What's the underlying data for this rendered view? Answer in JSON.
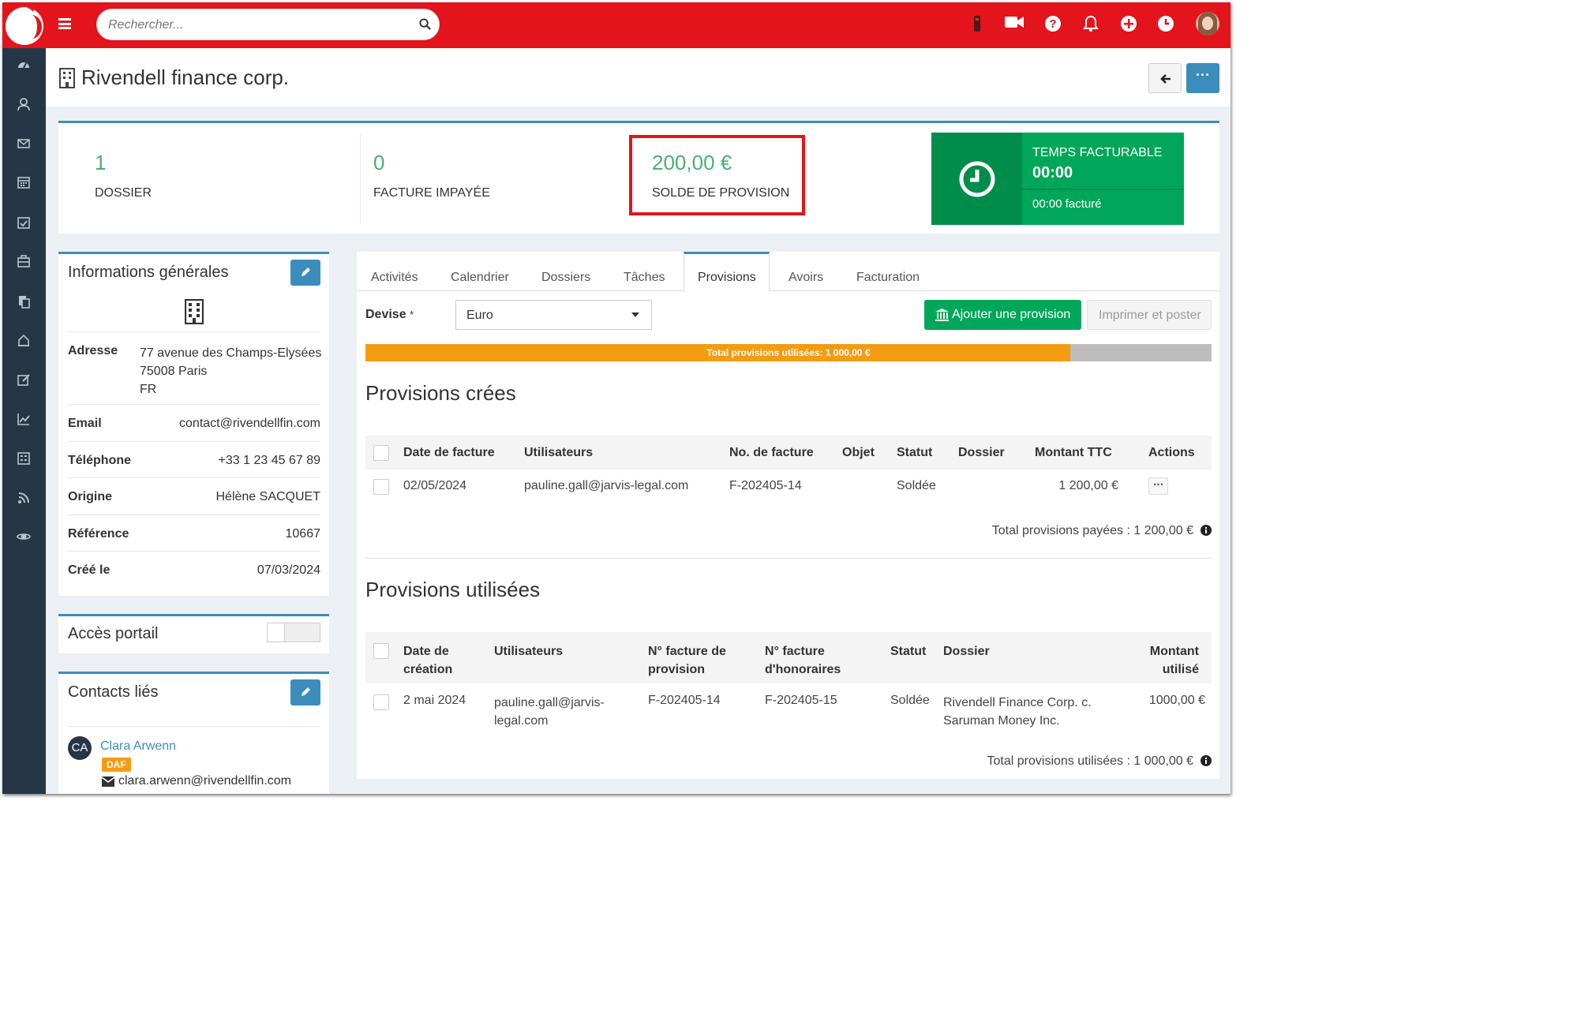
{
  "header": {
    "search_placeholder": "Rechercher..."
  },
  "page": {
    "title": "Rivendell finance corp."
  },
  "stats": {
    "dossier_count": "1",
    "dossier_label": "DOSSIER",
    "facture_count": "0",
    "facture_label": "FACTURE IMPAYÉE",
    "solde_value": "200,00 €",
    "solde_label": "SOLDE DE PROVISION",
    "temps_title": "TEMPS FACTURABLE",
    "temps_value": "00:00",
    "temps_facture": "00:00 facturé"
  },
  "info": {
    "title": "Informations générales",
    "rows": [
      {
        "label": "Adresse",
        "value": [
          "77 avenue des Champs-Elysées",
          "75008 Paris",
          "FR"
        ]
      },
      {
        "label": "Email",
        "value": "contact@rivendellfin.com"
      },
      {
        "label": "Téléphone",
        "value": "+33 1 23 45 67 89"
      },
      {
        "label": "Origine",
        "value": "Hélène SACQUET"
      },
      {
        "label": "Référence",
        "value": "10667"
      },
      {
        "label": "Créé le",
        "value": "07/03/2024"
      }
    ]
  },
  "portail": {
    "title": "Accès portail"
  },
  "contacts": {
    "title": "Contacts liés",
    "items": [
      {
        "initials": "CA",
        "name": "Clara Arwenn",
        "badge": "DAF",
        "email": "clara.arwenn@rivendellfin.com"
      }
    ]
  },
  "tabs": [
    "Activités",
    "Calendrier",
    "Dossiers",
    "Tâches",
    "Provisions",
    "Avoirs",
    "Facturation"
  ],
  "active_tab": "Provisions",
  "provisions": {
    "devise_label": "Devise",
    "devise_required": "*",
    "devise_value": "Euro",
    "add_button": "Ajouter une provision",
    "print_button": "Imprimer et poster",
    "progress_label": "Total provisions utilisées: 1 000,00 €",
    "progress_fraction": 0.833,
    "creees_title": "Provisions crées",
    "creees_headers": [
      "Date de facture",
      "Utilisateurs",
      "No. de facture",
      "Objet",
      "Statut",
      "Dossier",
      "Montant TTC",
      "Actions"
    ],
    "creees_rows": [
      {
        "date": "02/05/2024",
        "user": "pauline.gall@jarvis-legal.com",
        "facture": "F-202405-14",
        "objet": "",
        "statut": "Soldée",
        "dossier": "",
        "montant": "1 200,00 €",
        "actions": "⋯"
      }
    ],
    "creees_total": "Total provisions payées : 1 200,00 €",
    "utilisees_title": "Provisions utilisées",
    "utilisees_headers": {
      "date": [
        "Date de",
        "création"
      ],
      "user": "Utilisateurs",
      "prov": [
        "N° facture de",
        "provision"
      ],
      "hono": [
        "N° facture",
        "d'honoraires"
      ],
      "statut": "Statut",
      "dossier": "Dossier",
      "montant": [
        "Montant",
        "utilisé"
      ]
    },
    "utilisees_rows": [
      {
        "date": "2 mai 2024",
        "user": [
          "pauline.gall@jarvis-",
          "legal.com"
        ],
        "prov": "F-202405-14",
        "hono": "F-202405-15",
        "statut": "Soldée",
        "dossier": [
          "Rivendell Finance Corp. c.",
          "Saruman Money Inc."
        ],
        "montant": "1000,00 €"
      }
    ],
    "utilisees_total": "Total provisions utilisées : 1 000,00 €"
  },
  "colors": {
    "topbar": "#e3141b",
    "sidebar": "#253746",
    "accent": "#3c8dbc",
    "success": "#00a65a",
    "progress": "#f39c12",
    "highlight_box": "#e3141b"
  }
}
